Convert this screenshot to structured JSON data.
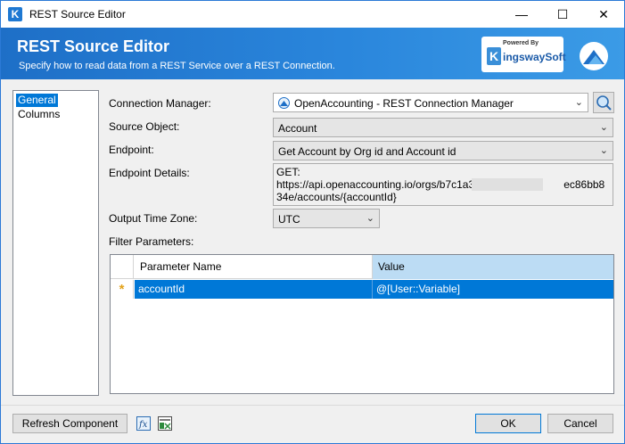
{
  "window": {
    "title": "REST Source Editor",
    "minimize_glyph": "—",
    "maximize_glyph": "☐",
    "close_glyph": "✕"
  },
  "header": {
    "title": "REST Source Editor",
    "subtitle": "Specify how to read data from a REST Service over a REST Connection.",
    "brand_powered": "Powered By",
    "brand_letter": "K",
    "brand_name": "ingswaySoft"
  },
  "nav": {
    "items": [
      {
        "label": "General",
        "selected": true
      },
      {
        "label": "Columns",
        "selected": false
      }
    ]
  },
  "form": {
    "connection_manager_label": "Connection Manager:",
    "connection_manager_value": "OpenAccounting - REST Connection Manager",
    "source_object_label": "Source Object:",
    "source_object_value": "Account",
    "endpoint_label": "Endpoint:",
    "endpoint_value": "Get Account by Org id and Account id",
    "endpoint_details_label": "Endpoint Details:",
    "endpoint_details_value": "GET:\nhttps://api.openaccounting.io/orgs/b7c1a3f22                         ec86bb834e/accounts/{accountId}",
    "output_time_zone_label": "Output Time Zone:",
    "output_time_zone_value": "UTC",
    "filter_parameters_label": "Filter Parameters:"
  },
  "grid": {
    "columns": [
      "Parameter Name",
      "Value"
    ],
    "rows": [
      {
        "marker": "*",
        "name": "accountId",
        "value": "@[User::Variable]"
      }
    ]
  },
  "footer": {
    "refresh_label": "Refresh Component",
    "ok_label": "OK",
    "cancel_label": "Cancel"
  },
  "icons": {
    "dropdown": "chevron-down-icon",
    "lookup": "magnifier-icon",
    "expression": "fx-icon",
    "excel": "excel-icon"
  },
  "colors": {
    "accent": "#0078d7",
    "banner": "#2a86dc",
    "star": "#e3a21a"
  }
}
